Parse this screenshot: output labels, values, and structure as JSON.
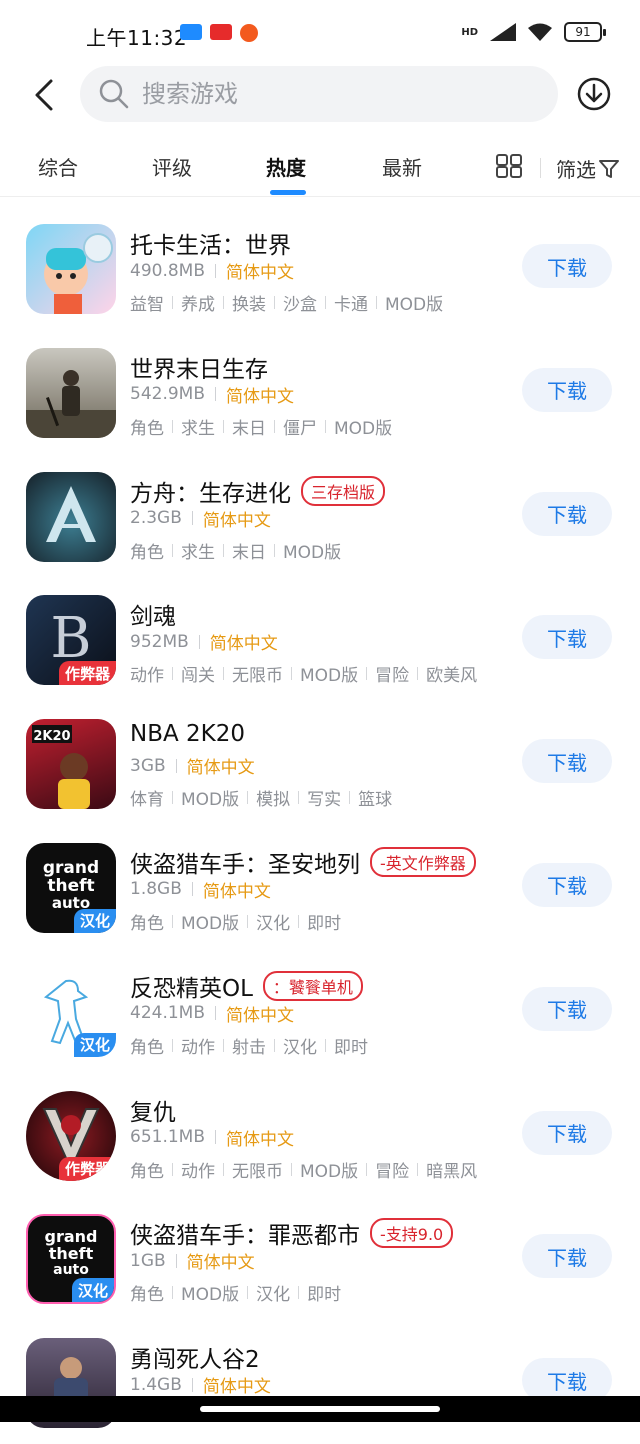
{
  "status": {
    "time": "上午11:32",
    "network": "HD",
    "battery": "91",
    "notify_icons": [
      "youku-icon",
      "toutiao-icon",
      "weibo-icon"
    ]
  },
  "search": {
    "placeholder": "搜索游戏"
  },
  "tabs": [
    {
      "label": "综合"
    },
    {
      "label": "评级"
    },
    {
      "label": "热度",
      "active": true
    },
    {
      "label": "最新"
    }
  ],
  "filter_label": "筛选",
  "download_label": "下载",
  "apps": [
    {
      "name": "托卡生活：世界",
      "size": "490.8MB",
      "lang": "简体中文",
      "pill": "",
      "icon_badge": "",
      "tags": [
        "益智",
        "养成",
        "换装",
        "沙盒",
        "卡通",
        "MOD版"
      ]
    },
    {
      "name": "世界末日生存",
      "size": "542.9MB",
      "lang": "简体中文",
      "pill": "",
      "icon_badge": "",
      "tags": [
        "角色",
        "求生",
        "末日",
        "僵尸",
        "MOD版"
      ]
    },
    {
      "name": "方舟：生存进化",
      "size": "2.3GB",
      "lang": "简体中文",
      "pill": "三存档版",
      "icon_badge": "",
      "tags": [
        "角色",
        "求生",
        "末日",
        "MOD版"
      ]
    },
    {
      "name": "剑魂",
      "size": "952MB",
      "lang": "简体中文",
      "pill": "",
      "icon_badge": "作弊器",
      "tags": [
        "动作",
        "闯关",
        "无限币",
        "MOD版",
        "冒险",
        "欧美风"
      ]
    },
    {
      "name": "NBA 2K20",
      "size": "3GB",
      "lang": "简体中文",
      "pill": "",
      "icon_badge": "",
      "tags": [
        "体育",
        "MOD版",
        "模拟",
        "写实",
        "篮球"
      ]
    },
    {
      "name": "侠盗猎车手：圣安地列",
      "size": "1.8GB",
      "lang": "简体中文",
      "pill": "-英文作弊器",
      "icon_badge": "汉化",
      "tags": [
        "角色",
        "MOD版",
        "汉化",
        "即时"
      ]
    },
    {
      "name": "反恐精英OL",
      "size": "424.1MB",
      "lang": "简体中文",
      "pill": "：饕餮单机",
      "icon_badge": "汉化",
      "tags": [
        "角色",
        "动作",
        "射击",
        "汉化",
        "即时"
      ]
    },
    {
      "name": "复仇",
      "size": "651.1MB",
      "lang": "简体中文",
      "pill": "",
      "icon_badge": "作弊器",
      "tags": [
        "角色",
        "动作",
        "无限币",
        "MOD版",
        "冒险",
        "暗黑风"
      ]
    },
    {
      "name": "侠盗猎车手：罪恶都市",
      "size": "1GB",
      "lang": "简体中文",
      "pill": "-支持9.0",
      "icon_badge": "汉化",
      "tags": [
        "角色",
        "MOD版",
        "汉化",
        "即时"
      ]
    },
    {
      "name": "勇闯死人谷2",
      "size": "1.4GB",
      "lang": "简体中文",
      "pill": "",
      "icon_badge": "",
      "tags": []
    }
  ]
}
